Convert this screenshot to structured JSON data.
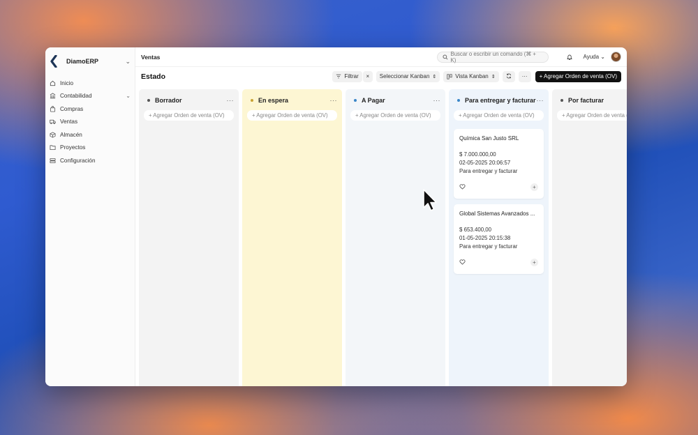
{
  "sidebar": {
    "brand": "DiamoERP",
    "items": [
      {
        "label": "Inicio",
        "icon": "home-icon"
      },
      {
        "label": "Contabilidad",
        "icon": "bank-icon",
        "expandable": true
      },
      {
        "label": "Compras",
        "icon": "bag-icon"
      },
      {
        "label": "Ventas",
        "icon": "truck-icon"
      },
      {
        "label": "Almacén",
        "icon": "box-icon"
      },
      {
        "label": "Proyectos",
        "icon": "folder-icon"
      },
      {
        "label": "Configuración",
        "icon": "server-icon"
      }
    ]
  },
  "topbar": {
    "breadcrumb": "Ventas",
    "search_placeholder": "Buscar o escribir un comando (⌘ + K)",
    "help_label": "Ayuda"
  },
  "toolbar": {
    "title": "Estado",
    "filter_label": "Filtrar",
    "select_kanban_label": "Seleccionar Kanban",
    "view_label": "Vista Kanban",
    "primary_label": "+ Agregar Orden de venta (OV)"
  },
  "board": {
    "add_label": "+ Agregar Orden de venta (OV)",
    "columns": [
      {
        "title": "Borrador",
        "bg": "#f3f3f3",
        "dot": "#555555"
      },
      {
        "title": "En espera",
        "bg": "#fdf6d3",
        "dot": "#c8a233"
      },
      {
        "title": "A Pagar",
        "bg": "#f3f6f9",
        "dot": "#3a86c8"
      },
      {
        "title": "Para entregar y facturar",
        "bg": "#eef4fb",
        "dot": "#3a86c8"
      },
      {
        "title": "Por facturar",
        "bg": "#f3f3f3",
        "dot": "#555555"
      }
    ],
    "cards": [
      {
        "title": "Química San Justo SRL",
        "amount": "$ 7.000.000,00",
        "date": "02-05-2025 20:06:57",
        "status": "Para entregar y facturar"
      },
      {
        "title": "Global Sistemas Avanzados ...",
        "amount": "$ 653.400,00",
        "date": "01-05-2025 20:15:38",
        "status": "Para entregar y facturar"
      }
    ]
  }
}
